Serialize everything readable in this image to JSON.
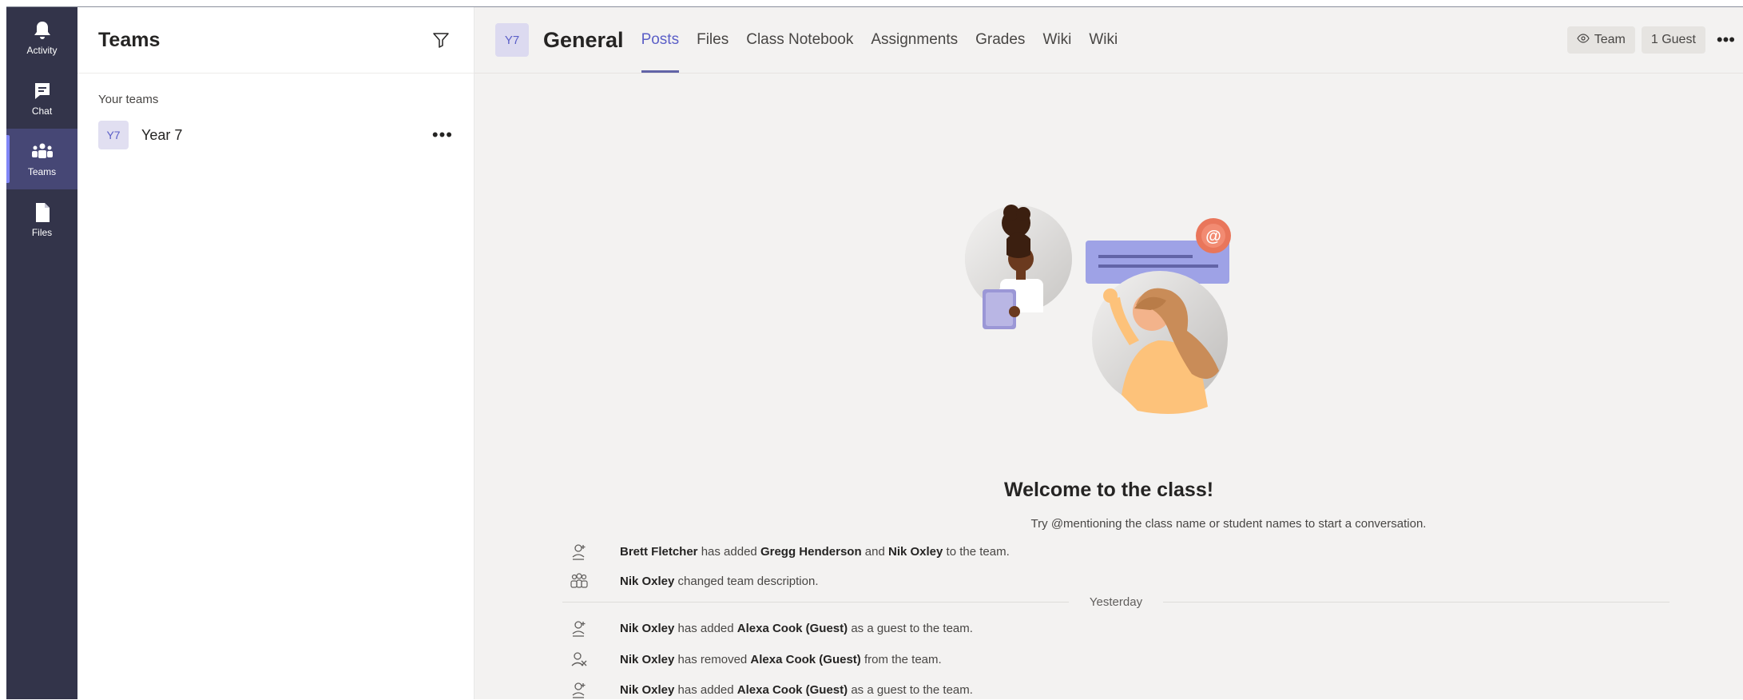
{
  "rail": {
    "items": [
      {
        "label": "Activity",
        "icon": "bell-icon"
      },
      {
        "label": "Chat",
        "icon": "chat-icon"
      },
      {
        "label": "Teams",
        "icon": "teams-icon",
        "active": true
      },
      {
        "label": "Files",
        "icon": "file-icon"
      }
    ]
  },
  "teams_pane": {
    "title": "Teams",
    "section_label": "Your teams",
    "teams": [
      {
        "initials": "Y7",
        "name": "Year 7"
      }
    ]
  },
  "channel": {
    "initials": "Y7",
    "name": "General",
    "tabs": [
      {
        "label": "Posts",
        "active": true
      },
      {
        "label": "Files"
      },
      {
        "label": "Class Notebook"
      },
      {
        "label": "Assignments"
      },
      {
        "label": "Grades"
      },
      {
        "label": "Wiki"
      },
      {
        "label": "Wiki"
      }
    ],
    "team_button": "Team",
    "guest_button": "1 Guest"
  },
  "welcome": {
    "title": "Welcome to the class!",
    "subtitle": "Try @mentioning the class name or student names to start a conversation."
  },
  "activity": [
    {
      "icon": "person-add-icon",
      "actor": "Brett Fletcher",
      "text1": " has added ",
      "target": "Gregg Henderson",
      "text2": " and ",
      "target2": "Nik Oxley",
      "text3": " to the team."
    },
    {
      "icon": "team-edit-icon",
      "actor": "Nik Oxley",
      "text1": " changed team description.",
      "target": "",
      "text2": "",
      "target2": "",
      "text3": ""
    },
    {
      "icon": "person-add-icon",
      "actor": "Nik Oxley",
      "text1": " has added ",
      "target": "Alexa Cook (Guest)",
      "text2": " as a guest to the team.",
      "target2": "",
      "text3": ""
    },
    {
      "icon": "person-remove-icon",
      "actor": "Nik Oxley",
      "text1": " has removed ",
      "target": "Alexa Cook (Guest)",
      "text2": " from the team.",
      "target2": "",
      "text3": ""
    },
    {
      "icon": "person-add-icon",
      "actor": "Nik Oxley",
      "text1": " has added ",
      "target": "Alexa Cook (Guest)",
      "text2": " as a guest to the team.",
      "target2": "",
      "text3": ""
    }
  ],
  "divider_label": "Yesterday",
  "colors": {
    "rail_bg": "#33344a",
    "accent": "#6264a7",
    "main_bg": "#f3f2f1"
  }
}
